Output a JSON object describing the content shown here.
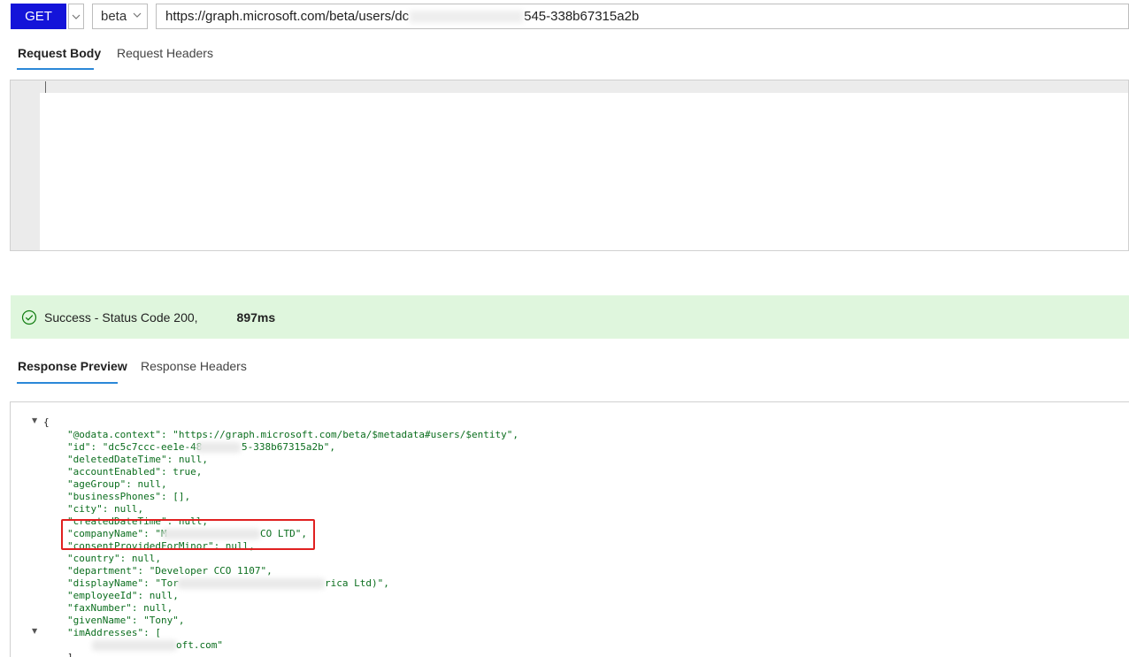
{
  "request": {
    "method": "GET",
    "version": "beta",
    "url": "https://graph.microsoft.com/beta/users/dc",
    "url_tail": "545-338b67315a2b"
  },
  "request_tabs": [
    {
      "label": "Request Body",
      "active": true
    },
    {
      "label": "Request Headers",
      "active": false
    }
  ],
  "status": {
    "text": "Success - Status Code 200,",
    "time": "897ms",
    "color": "#dff6dd"
  },
  "response_tabs": [
    {
      "label": "Response Preview",
      "active": true
    },
    {
      "label": "Response Headers",
      "active": false
    }
  ],
  "response_lines": [
    "{",
    "\"@odata.context\": \"https://graph.microsoft.com/beta/$metadata#users/$entity\",",
    "\"id\": \"dc5c7ccc-ee1e-48",
    "5-338b67315a2b\",",
    "\"deletedDateTime\": null,",
    "\"accountEnabled\": true,",
    "\"ageGroup\": null,",
    "\"businessPhones\": [],",
    "\"city\": null,",
    "\"createdDateTime\": null,",
    "\"companyName\": \"M",
    "CO LTD\",",
    "\"consentProvidedForMinor\": null,",
    "\"country\": null,",
    "\"department\": \"Developer CCO 1107\",",
    "\"displayName\": \"Tor",
    "rica Ltd)\",",
    "\"employeeId\": null,",
    "\"faxNumber\": null,",
    "\"givenName\": \"Tony\",",
    "\"imAddresses\": [",
    "oft.com\"",
    "],"
  ],
  "icons": {
    "success": "check-circle-icon",
    "caret": "chevron-down-icon",
    "fold": "triangle-down-icon"
  },
  "accent_color": "#1414d9",
  "tab_underline_color": "#2b88d8",
  "highlight_color": "#e02020"
}
